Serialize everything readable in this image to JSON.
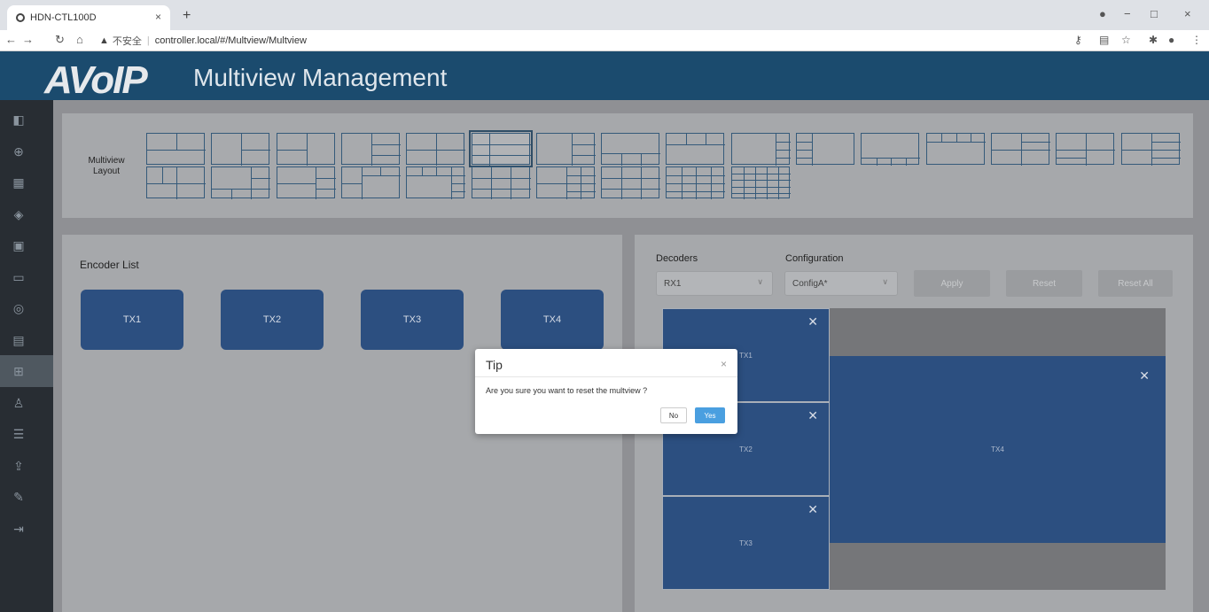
{
  "browser": {
    "tab_title": "HDN-CTL100D",
    "tab_close": "×",
    "new_tab": "+",
    "security_icon": "▲",
    "security_text": "不安全",
    "url": "controller.local/#/Multview/Multview",
    "controls": [
      "−",
      "□",
      "×"
    ]
  },
  "app": {
    "logo": "AVoIP",
    "title": "Multiview Management"
  },
  "sidebar": {
    "items": [
      {
        "name": "monitor-icon",
        "glyph": "◧"
      },
      {
        "name": "add-circle-icon",
        "glyph": "⊕"
      },
      {
        "name": "grid-icon",
        "glyph": "▦"
      },
      {
        "name": "layers-icon",
        "glyph": "◈"
      },
      {
        "name": "display-icon",
        "glyph": "▣"
      },
      {
        "name": "screen-icon",
        "glyph": "▭"
      },
      {
        "name": "settings-circle-icon",
        "glyph": "◎"
      },
      {
        "name": "matrix-icon",
        "glyph": "▤"
      },
      {
        "name": "multiview-icon",
        "glyph": "⊞"
      },
      {
        "name": "user-icon",
        "glyph": "♙"
      },
      {
        "name": "sliders-icon",
        "glyph": "☰"
      },
      {
        "name": "upload-icon",
        "glyph": "⇪"
      },
      {
        "name": "wrench-icon",
        "glyph": "✎"
      },
      {
        "name": "logout-icon",
        "glyph": "⇥"
      }
    ]
  },
  "layout_panel": {
    "label_line1": "Multiview",
    "label_line2": "Layout"
  },
  "encoder_panel": {
    "label": "Encoder List",
    "encoders": [
      "TX1",
      "TX2",
      "TX3",
      "TX4"
    ]
  },
  "decoder_panel": {
    "decoders_label": "Decoders",
    "config_label": "Configuration",
    "decoder_value": "RX1",
    "config_value": "ConfigA*",
    "apply_label": "Apply",
    "reset_label": "Reset",
    "reset_all_label": "Reset All",
    "windows": [
      "TX1",
      "TX2",
      "TX3",
      "TX4"
    ],
    "close_glyph": "✕"
  },
  "modal": {
    "title": "Tip",
    "close": "×",
    "message": "Are you sure you want to reset the multview ?",
    "no_label": "No",
    "yes_label": "Yes"
  }
}
